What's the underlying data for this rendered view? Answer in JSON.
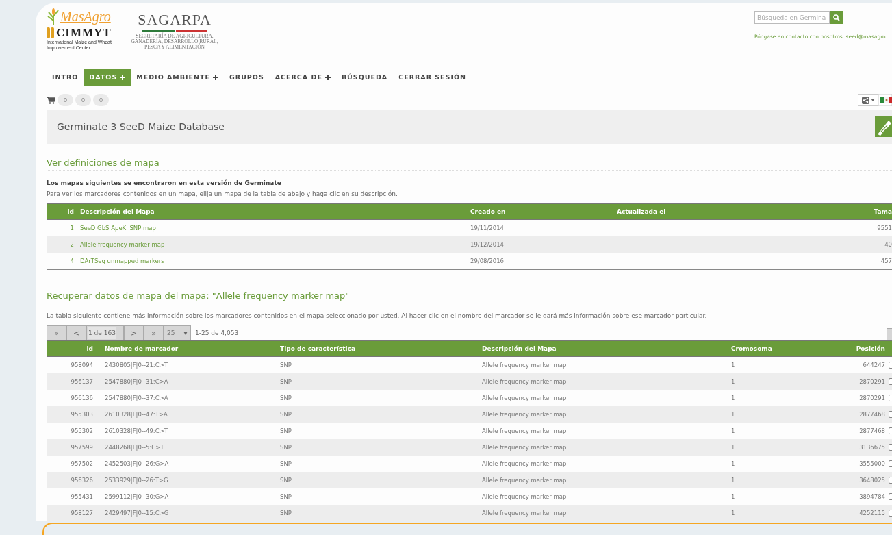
{
  "logos": {
    "masagro": "MasAgro",
    "cimmyt": "CIMMYT",
    "cimmyt_subtitle": "International Maize and Wheat Improvement Center",
    "sagarpa": "SAGARPA",
    "sagarpa_subtitle": "SECRETARÍA DE AGRICULTURA, GANADERÍA, DESARROLLO RURAL, PESCA Y ALIMENTACIÓN"
  },
  "search": {
    "placeholder": "Búsqueda en Germina"
  },
  "contact": "Póngase en contacto con nosotros: seed@masagro",
  "nav": [
    {
      "label": "INTRO",
      "selected": false,
      "has_menu": false
    },
    {
      "label": "DATOS",
      "selected": true,
      "has_menu": true
    },
    {
      "label": "MEDIO AMBIENTE",
      "selected": false,
      "has_menu": true
    },
    {
      "label": "GRUPOS",
      "selected": false,
      "has_menu": false
    },
    {
      "label": "ACERCA DE",
      "selected": false,
      "has_menu": true
    },
    {
      "label": "BÚSQUEDA",
      "selected": false,
      "has_menu": false
    },
    {
      "label": "CERRAR SESIÓN",
      "selected": false,
      "has_menu": false
    }
  ],
  "cart_counts": [
    "0",
    "0",
    "0"
  ],
  "page_title": "Germinate 3 SeeD Maize Database",
  "maps_section": {
    "heading": "Ver definiciones de mapa",
    "intro_bold": "Los mapas siguientes se encontraron en esta versión de Germinate",
    "intro": "Para ver los marcadores contenidos en un mapa, elija un mapa de la tabla de abajo y haga clic en su descripción.",
    "table": {
      "columns": [
        "id",
        "Descripción del Mapa",
        "Creado en",
        "Actualizada el",
        "Tama"
      ],
      "rows": [
        [
          "1",
          "SeeD GbS ApeKI SNP map",
          "19/11/2014",
          "",
          "9551"
        ],
        [
          "2",
          "Allele frequency marker map",
          "19/12/2014",
          "",
          "40"
        ],
        [
          "4",
          "DArTSeq unmapped markers",
          "29/08/2016",
          "",
          "457"
        ]
      ]
    }
  },
  "data_section": {
    "heading": "Recuperar datos de mapa del mapa: \"Allele frequency marker map\"",
    "description": "La tabla siguiente contiene más información sobre los marcadores contenidos en el mapa seleccionado por usted. Al hacer clic en el nombre del marcador se le dará más información sobre ese marcador particular.",
    "pager": {
      "first": "«",
      "prev": "<",
      "page": "1 de 163",
      "next": ">",
      "last": "»",
      "page_size": "25",
      "range": "1-25 de 4,053"
    },
    "table": {
      "columns": [
        "id",
        "Nombre de marcador",
        "Tipo de característica",
        "Descripción del Mapa",
        "Cromosoma",
        "Posición"
      ],
      "rows": [
        {
          "cells": [
            "958094",
            "2430805|F|0--21:C>T",
            "SNP",
            "Allele frequency marker map",
            "1",
            "644247"
          ],
          "checked": false
        },
        {
          "cells": [
            "956137",
            "2547880|F|0--31:C>A",
            "SNP",
            "Allele frequency marker map",
            "1",
            "2870291"
          ],
          "checked": false
        },
        {
          "cells": [
            "956136",
            "2547880|F|0--37:C>A",
            "SNP",
            "Allele frequency marker map",
            "1",
            "2870291"
          ],
          "checked": false
        },
        {
          "cells": [
            "955303",
            "2610328|F|0--47:T>A",
            "SNP",
            "Allele frequency marker map",
            "1",
            "2877468"
          ],
          "checked": false
        },
        {
          "cells": [
            "955302",
            "2610328|F|0--49:C>T",
            "SNP",
            "Allele frequency marker map",
            "1",
            "2877468"
          ],
          "checked": false
        },
        {
          "cells": [
            "957599",
            "2448268|F|0--5:C>T",
            "SNP",
            "Allele frequency marker map",
            "1",
            "3136675"
          ],
          "checked": false
        },
        {
          "cells": [
            "957502",
            "2452503|F|0--26:G>A",
            "SNP",
            "Allele frequency marker map",
            "1",
            "3555000"
          ],
          "checked": false
        },
        {
          "cells": [
            "956326",
            "2533929|F|0--26:T>G",
            "SNP",
            "Allele frequency marker map",
            "1",
            "3648025"
          ],
          "checked": false
        },
        {
          "cells": [
            "955431",
            "2599112|F|0--30:G>A",
            "SNP",
            "Allele frequency marker map",
            "1",
            "3894784"
          ],
          "checked": false
        },
        {
          "cells": [
            "958127",
            "2429497|F|0--15:C>G",
            "SNP",
            "Allele frequency marker map",
            "1",
            "4252115"
          ],
          "checked": false
        }
      ]
    }
  }
}
